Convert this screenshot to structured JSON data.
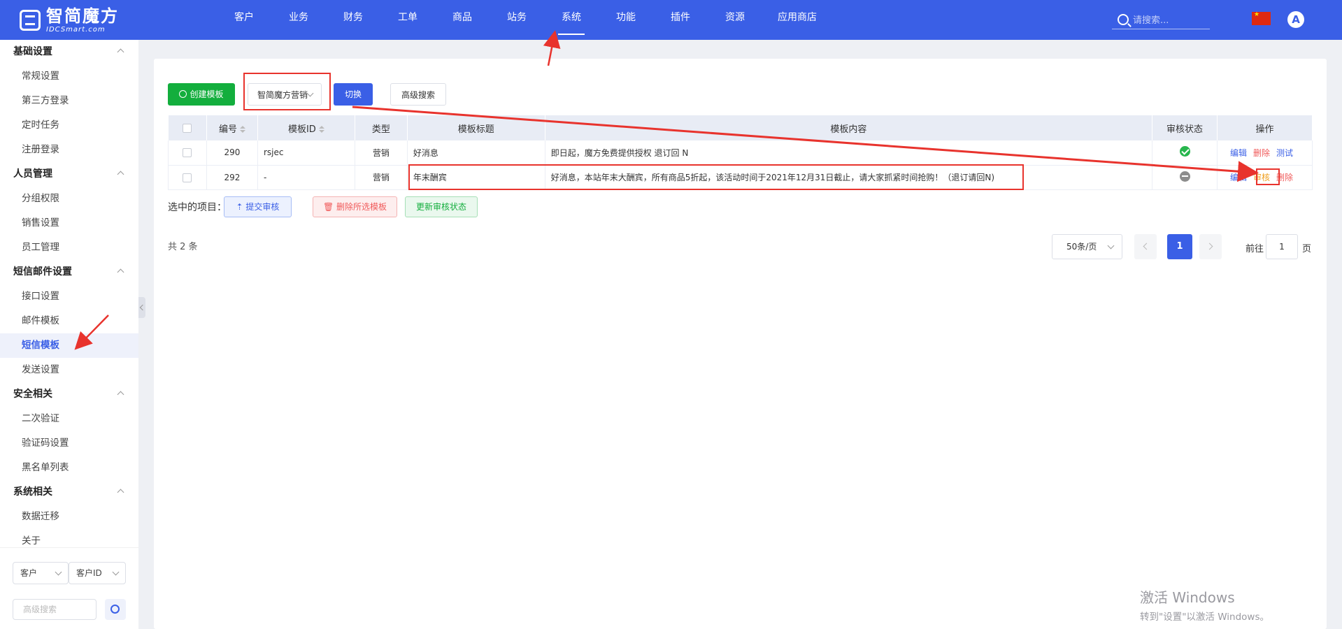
{
  "brand": {
    "name_cn": "智简魔方",
    "name_en": "IDCSmart.com",
    "color": "#3a5fe6"
  },
  "nav": {
    "items": [
      "客户",
      "业务",
      "财务",
      "工单",
      "商品",
      "站务",
      "系统",
      "功能",
      "插件",
      "资源",
      "应用商店"
    ],
    "active": "系统",
    "search_placeholder": "请搜索...",
    "avatar_letter": "A"
  },
  "sidebar": {
    "groups": [
      {
        "title": "基础设置",
        "items": [
          "常规设置",
          "第三方登录",
          "定时任务",
          "注册登录"
        ]
      },
      {
        "title": "人员管理",
        "items": [
          "分组权限",
          "销售设置",
          "员工管理"
        ]
      },
      {
        "title": "短信邮件设置",
        "items": [
          "接口设置",
          "邮件模板",
          "短信模板",
          "发送设置"
        ]
      },
      {
        "title": "安全相关",
        "items": [
          "二次验证",
          "验证码设置",
          "黑名单列表"
        ]
      },
      {
        "title": "系统相关",
        "items": [
          "数据迁移",
          "关于"
        ]
      }
    ],
    "active_item": "短信模板",
    "bottom": {
      "select_1": "客户",
      "select_2": "客户ID",
      "search_placeholder": "高级搜索"
    }
  },
  "toolbar": {
    "create_label": "创建模板",
    "template_select_value": "智简魔方营销",
    "switch_label": "切换",
    "advanced_search_label": "高级搜索"
  },
  "table": {
    "headers": [
      "编号",
      "模板ID",
      "类型",
      "模板标题",
      "模板内容",
      "审核状态",
      "操作"
    ],
    "rows": [
      {
        "id": "290",
        "template_id": "rsjec",
        "type": "营销",
        "title": "好消息",
        "content": "即日起，魔方免费提供授权 退订回 N",
        "status": "approved",
        "actions": [
          "编辑",
          "删除",
          "测试"
        ]
      },
      {
        "id": "292",
        "template_id": "-",
        "type": "营销",
        "title": "年末酬宾",
        "content": "好消息，本站年末大酬宾，所有商品5折起，该活动时间于2021年12月31日截止，请大家抓紧时间抢购！（退订请回N)",
        "status": "pending",
        "actions": [
          "编辑",
          "审核",
          "删除"
        ]
      }
    ]
  },
  "selection": {
    "label": "选中的项目：",
    "submit_label": "提交审核",
    "delete_label": "删除所选模板",
    "update_label": "更新审核状态"
  },
  "pagination": {
    "total_text": "共 2 条",
    "page_size": "50条/页",
    "current_page": "1",
    "goto_label": "前往",
    "goto_value": "1",
    "goto_unit": "页"
  },
  "watermark": {
    "line1": "激活 Windows",
    "line2": "转到\"设置\"以激活 Windows。"
  },
  "colors": {
    "green": "#13ae3d",
    "red": "#f05a5a",
    "orange": "#f0a020",
    "annotation": "#e8332d"
  }
}
